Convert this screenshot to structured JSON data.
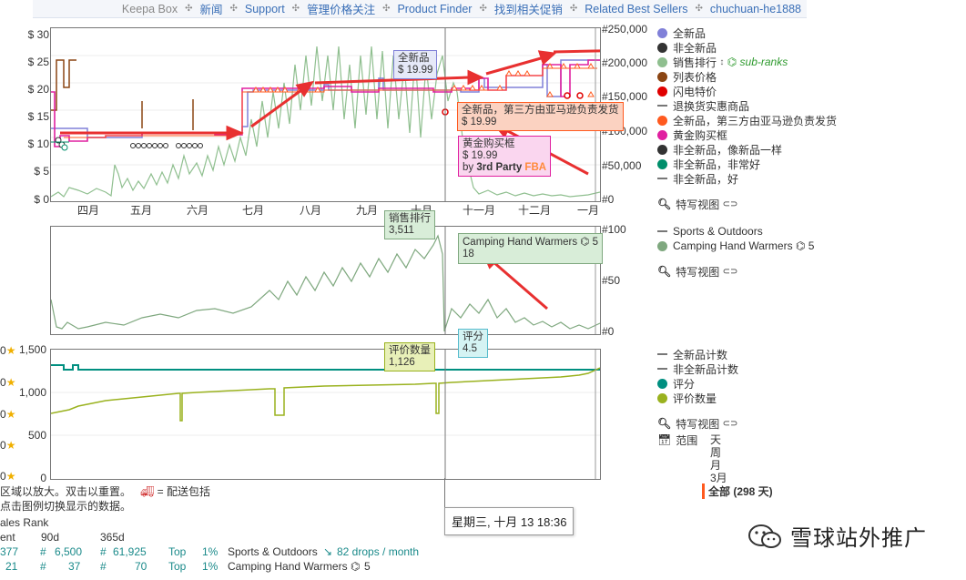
{
  "nav": {
    "items": [
      "Keepa Box",
      "新闻",
      "Support",
      "管理价格关注",
      "Product Finder",
      "找到相关促销",
      "Related Best Sellers",
      "chuchuan-he1888"
    ]
  },
  "price_chart": {
    "left_ticks": [
      "$ 30",
      "$ 25",
      "$ 20",
      "$ 15",
      "$ 10",
      "$ 5",
      "$ 0"
    ],
    "right_ticks": [
      "#250,000",
      "#200,000",
      "#150,000",
      "#100,000",
      "#50,000",
      "#0"
    ],
    "months": [
      "四月",
      "五月",
      "六月",
      "七月",
      "八月",
      "九月",
      "十月",
      "十一月",
      "十二月",
      "一月"
    ]
  },
  "rank_chart": {
    "right_ticks": [
      "#100",
      "#50",
      "#0"
    ]
  },
  "rating_chart": {
    "left_ticks": [
      "1,500",
      "1,000",
      "500",
      "0"
    ],
    "star_labels": [
      "0",
      "0",
      "0",
      "0",
      "0"
    ]
  },
  "tooltips": {
    "new": {
      "title": "全新品",
      "value": "$ 19.99"
    },
    "third_party": {
      "title": "全新品，第三方由亚马逊负责发货",
      "value": "$ 19.99"
    },
    "buybox": {
      "title": "黄金购买框",
      "value": "$ 19.99",
      "by": "by",
      "seller": "3rd Party",
      "fba": "FBA"
    },
    "sales_rank": {
      "title": "销售排行",
      "value": "3,511"
    },
    "subcat": {
      "title": "Camping Hand Warmers",
      "value": "18",
      "suffix": "5"
    },
    "rating_count": {
      "title": "评价数量",
      "value": "1,126"
    },
    "rating": {
      "title": "评分",
      "value": "4.5"
    },
    "date": "星期三, 十月 13 18:36"
  },
  "legend_price": [
    {
      "label": "全新品",
      "color": "#8080d8",
      "kind": "dot"
    },
    {
      "label": "非全新品",
      "color": "#333333",
      "kind": "dot"
    },
    {
      "label": "销售排行",
      "color": "#8fbf8f",
      "kind": "dot",
      "extra": "sub-ranks"
    },
    {
      "label": "列表价格",
      "color": "#8b4513",
      "kind": "dot"
    },
    {
      "label": "闪电特价",
      "color": "#e00000",
      "kind": "dot"
    },
    {
      "label": "退换货实惠商品",
      "color": "#999999",
      "kind": "dash"
    },
    {
      "label": "全新品，第三方由亚马逊负责发货",
      "color": "#ff5a1f",
      "kind": "dot"
    },
    {
      "label": "黄金购买框",
      "color": "#e020a0",
      "kind": "dot"
    },
    {
      "label": "非全新品，像新品一样",
      "color": "#333333",
      "kind": "dot"
    },
    {
      "label": "非全新品，非常好",
      "color": "#008f6b",
      "kind": "dot"
    },
    {
      "label": "非全新品，好",
      "color": "#999999",
      "kind": "dash"
    }
  ],
  "legend_closeup_1": "特写视图",
  "legend_rank": [
    {
      "label": "Sports & Outdoors",
      "color": "#999999",
      "kind": "dash"
    },
    {
      "label": "Camping Hand Warmers",
      "color": "#7fa87f",
      "kind": "dot",
      "suffix": "5"
    }
  ],
  "legend_closeup_2": "特写视图",
  "legend_rating": [
    {
      "label": "全新品计数",
      "color": "#999999",
      "kind": "dash"
    },
    {
      "label": "非全新品计数",
      "color": "#999999",
      "kind": "dash"
    },
    {
      "label": "评分",
      "color": "#008f80",
      "kind": "dot"
    },
    {
      "label": "评价数量",
      "color": "#9ab21f",
      "kind": "dot"
    }
  ],
  "legend_closeup_3": "特写视图",
  "range": {
    "label": "范围",
    "options": [
      "天",
      "周",
      "月",
      "3月"
    ],
    "selected": "全部 (298 天)"
  },
  "hints": {
    "line1": "区域以放大。双击以重置。",
    "delivery": "= 配送包括",
    "line2": "点击图例切换显示的数据。"
  },
  "sales_table": {
    "title": "ales Rank",
    "headers": [
      "ent",
      "90d",
      "365d"
    ],
    "rows": [
      {
        "cur": "377",
        "d90": "6,500",
        "d365": "61,925",
        "top": "Top",
        "pct": "1%",
        "cat": "Sports & Outdoors",
        "drops": "82 drops / month"
      },
      {
        "cur": "21",
        "d90": "37",
        "d365": "70",
        "top": "Top",
        "pct": "1%",
        "cat": "Camping Hand Warmers",
        "catsuffix": "5"
      }
    ]
  },
  "watermark": "雪球站外推广"
}
